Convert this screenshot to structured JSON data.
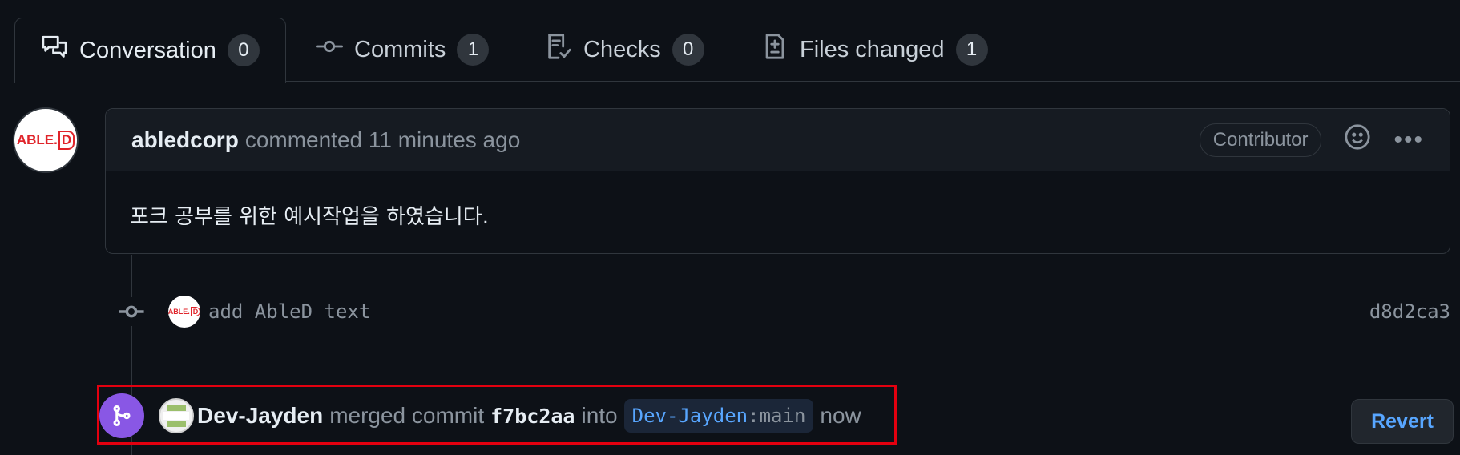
{
  "tabs": [
    {
      "label": "Conversation",
      "count": "0",
      "icon": "comment-discussion-icon"
    },
    {
      "label": "Commits",
      "count": "1",
      "icon": "git-commit-icon"
    },
    {
      "label": "Checks",
      "count": "0",
      "icon": "checklist-icon"
    },
    {
      "label": "Files changed",
      "count": "1",
      "icon": "file-diff-icon"
    }
  ],
  "comment": {
    "author": "abledcorp",
    "action": "commented 11 minutes ago",
    "role": "Contributor",
    "body": "포크 공부를 위한 예시작업을 하였습니다.",
    "avatar_text": "ABLE.",
    "avatar_letter": "D"
  },
  "commit": {
    "message": "add AbleD text",
    "sha": "d8d2ca3"
  },
  "merge": {
    "user": "Dev-Jayden",
    "verb": "merged commit",
    "commit": "f7bc2aa",
    "into": "into",
    "branch_owner": "Dev-Jayden",
    "branch_sep": ":",
    "branch_name": "main",
    "time": "now",
    "revert_label": "Revert"
  },
  "colors": {
    "background": "#0d1117",
    "merge_purple": "#8957e5",
    "link_blue": "#58a6ff",
    "highlight_red": "#e3000f"
  }
}
